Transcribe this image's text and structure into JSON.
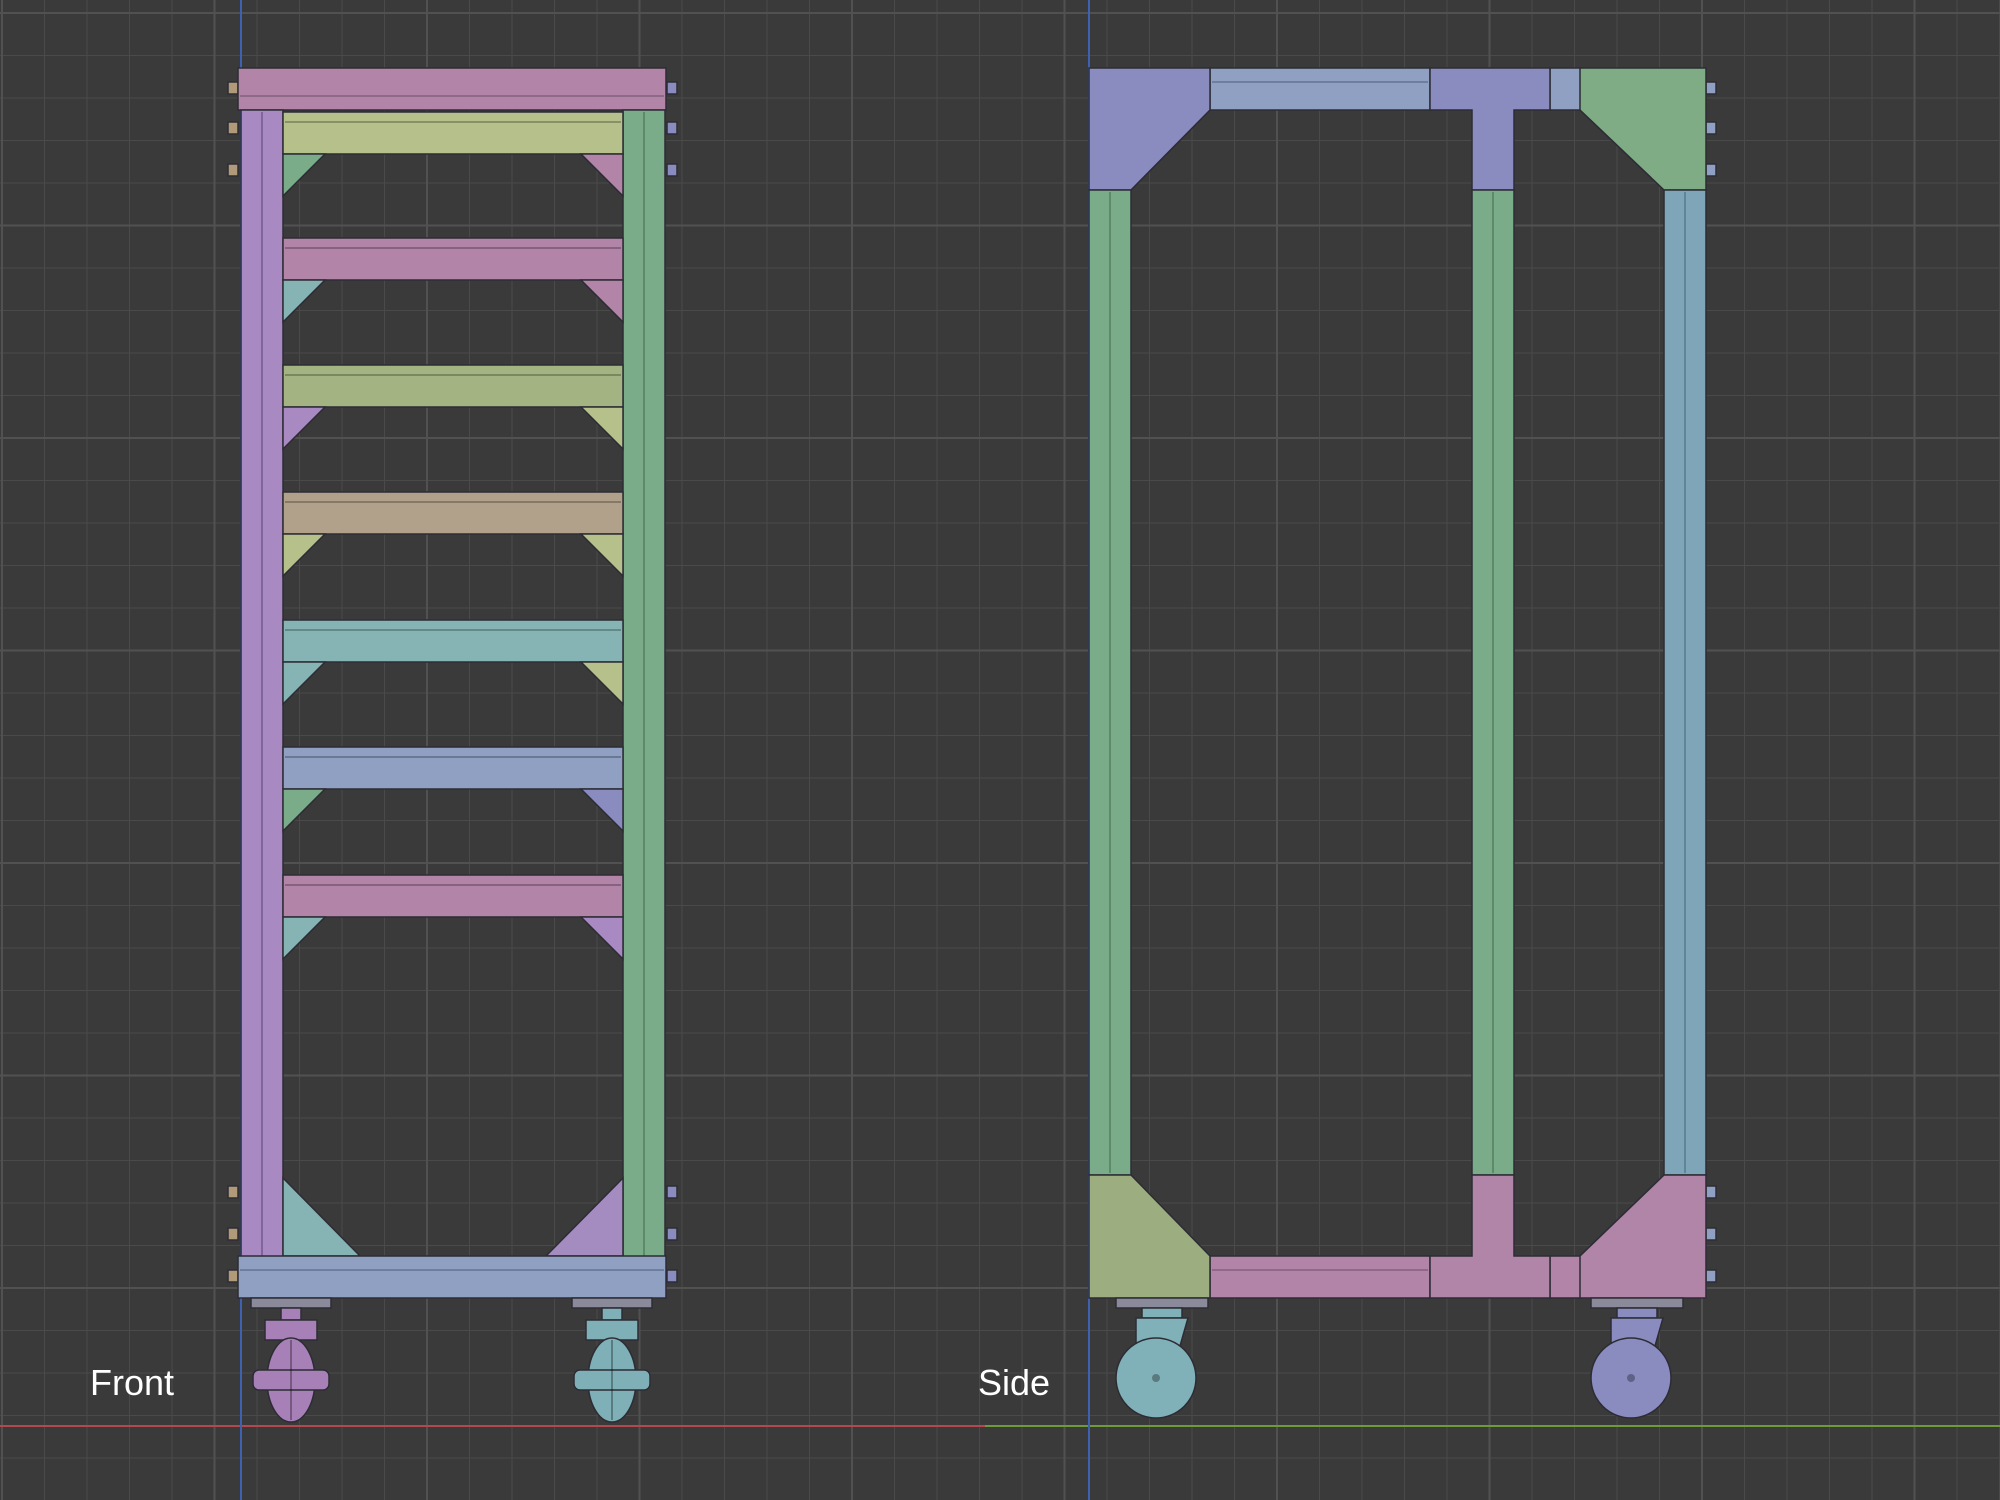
{
  "viewport": {
    "background": "#3a3a3a",
    "grid_color": "#4a4a4a",
    "axis_x_color": "#b5474e",
    "axis_y_color": "#6f9a3a",
    "axis_z_color": "#3f62b0"
  },
  "labels": {
    "front": "Front",
    "side": "Side"
  },
  "palette": {
    "lilac": "#a889c2",
    "green": "#7aac8a",
    "pink": "#b284a8",
    "yellow": "#b5c08a",
    "olive": "#a3b482",
    "sand": "#b1a18b",
    "teal": "#86b4b4",
    "blue": "#8fa0c2",
    "periwinkle": "#8a8cc0",
    "sage": "#9cae80",
    "steel": "#7ea6b8"
  },
  "views": [
    {
      "name": "front",
      "object": "rack-model"
    },
    {
      "name": "side",
      "object": "rack-model"
    }
  ]
}
